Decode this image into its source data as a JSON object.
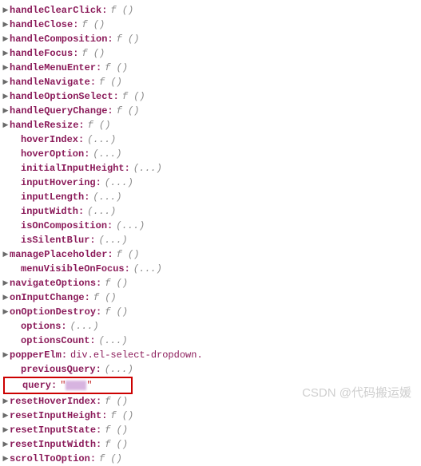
{
  "items": [
    {
      "key": "handleClearClick",
      "value": "f ()",
      "type": "func",
      "expandable": true,
      "indent": false
    },
    {
      "key": "handleClose",
      "value": "f ()",
      "type": "func",
      "expandable": true,
      "indent": false
    },
    {
      "key": "handleComposition",
      "value": "f ()",
      "type": "func",
      "expandable": true,
      "indent": false
    },
    {
      "key": "handleFocus",
      "value": "f ()",
      "type": "func",
      "expandable": true,
      "indent": false
    },
    {
      "key": "handleMenuEnter",
      "value": "f ()",
      "type": "func",
      "expandable": true,
      "indent": false
    },
    {
      "key": "handleNavigate",
      "value": "f ()",
      "type": "func",
      "expandable": true,
      "indent": false
    },
    {
      "key": "handleOptionSelect",
      "value": "f ()",
      "type": "func",
      "expandable": true,
      "indent": false
    },
    {
      "key": "handleQueryChange",
      "value": "f ()",
      "type": "func",
      "expandable": true,
      "indent": false
    },
    {
      "key": "handleResize",
      "value": "f ()",
      "type": "func",
      "expandable": true,
      "indent": false
    },
    {
      "key": "hoverIndex",
      "value": "(...)",
      "type": "ellipsis",
      "expandable": false,
      "indent": true
    },
    {
      "key": "hoverOption",
      "value": "(...)",
      "type": "ellipsis",
      "expandable": false,
      "indent": true
    },
    {
      "key": "initialInputHeight",
      "value": "(...)",
      "type": "ellipsis",
      "expandable": false,
      "indent": true
    },
    {
      "key": "inputHovering",
      "value": "(...)",
      "type": "ellipsis",
      "expandable": false,
      "indent": true
    },
    {
      "key": "inputLength",
      "value": "(...)",
      "type": "ellipsis",
      "expandable": false,
      "indent": true
    },
    {
      "key": "inputWidth",
      "value": "(...)",
      "type": "ellipsis",
      "expandable": false,
      "indent": true
    },
    {
      "key": "isOnComposition",
      "value": "(...)",
      "type": "ellipsis",
      "expandable": false,
      "indent": true
    },
    {
      "key": "isSilentBlur",
      "value": "(...)",
      "type": "ellipsis",
      "expandable": false,
      "indent": true
    },
    {
      "key": "managePlaceholder",
      "value": "f ()",
      "type": "func",
      "expandable": true,
      "indent": false
    },
    {
      "key": "menuVisibleOnFocus",
      "value": "(...)",
      "type": "ellipsis",
      "expandable": false,
      "indent": true
    },
    {
      "key": "navigateOptions",
      "value": "f ()",
      "type": "func",
      "expandable": true,
      "indent": false
    },
    {
      "key": "onInputChange",
      "value": "f ()",
      "type": "func",
      "expandable": true,
      "indent": false
    },
    {
      "key": "onOptionDestroy",
      "value": "f ()",
      "type": "func",
      "expandable": true,
      "indent": false
    },
    {
      "key": "options",
      "value": "(...)",
      "type": "ellipsis",
      "expandable": false,
      "indent": true
    },
    {
      "key": "optionsCount",
      "value": "(...)",
      "type": "ellipsis",
      "expandable": false,
      "indent": true
    },
    {
      "key": "popperElm",
      "value": "div.el-select-dropdown.",
      "type": "dom",
      "expandable": true,
      "indent": false
    },
    {
      "key": "previousQuery",
      "value": "(...)",
      "type": "ellipsis",
      "expandable": false,
      "indent": true
    },
    {
      "key": "query",
      "value": "\"***\"",
      "type": "str",
      "expandable": false,
      "indent": true,
      "highlight": true
    },
    {
      "key": "resetHoverIndex",
      "value": "f ()",
      "type": "func",
      "expandable": true,
      "indent": false
    },
    {
      "key": "resetInputHeight",
      "value": "f ()",
      "type": "func",
      "expandable": true,
      "indent": false
    },
    {
      "key": "resetInputState",
      "value": "f ()",
      "type": "func",
      "expandable": true,
      "indent": false
    },
    {
      "key": "resetInputWidth",
      "value": "f ()",
      "type": "func",
      "expandable": true,
      "indent": false
    },
    {
      "key": "scrollToOption",
      "value": "f ()",
      "type": "func",
      "expandable": true,
      "indent": false
    }
  ],
  "watermark": "CSDN @代码搬运媛"
}
